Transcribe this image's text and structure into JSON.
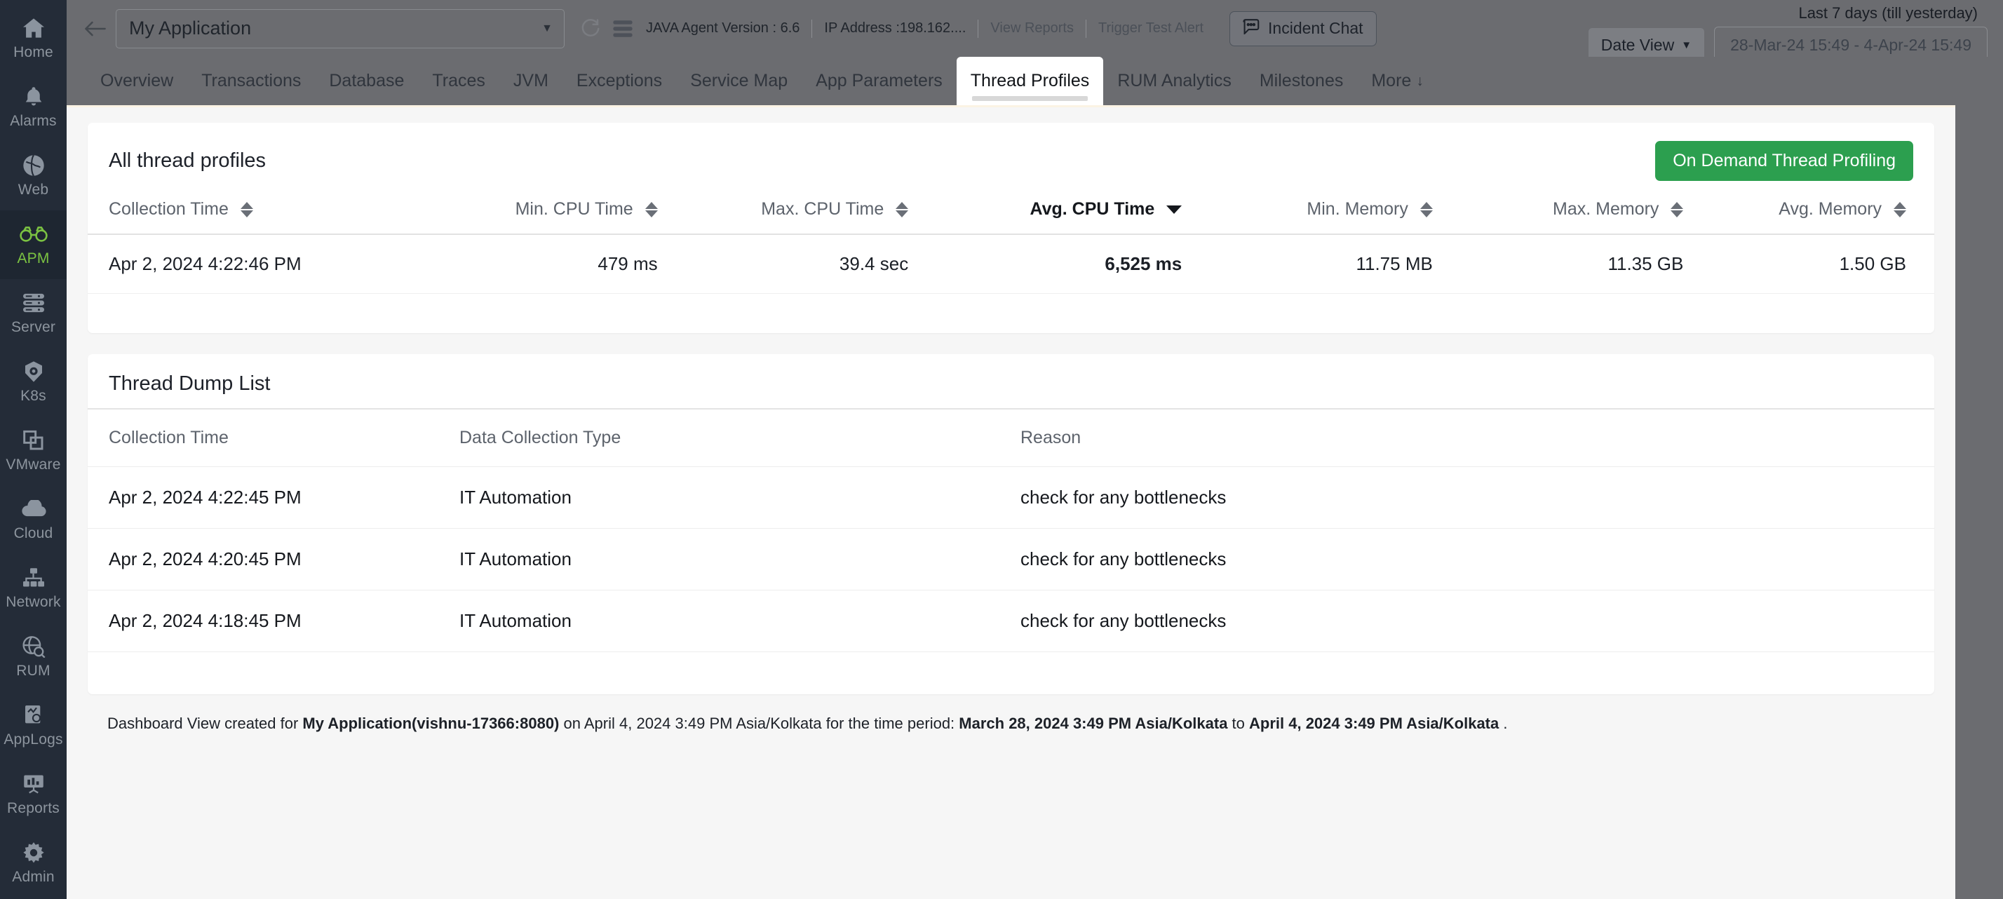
{
  "sidebar": {
    "items": [
      {
        "label": "Home",
        "icon": "home-icon",
        "active": false
      },
      {
        "label": "Alarms",
        "icon": "bell-icon",
        "active": false
      },
      {
        "label": "Web",
        "icon": "globe-icon",
        "active": false
      },
      {
        "label": "APM",
        "icon": "binoculars-icon",
        "active": true
      },
      {
        "label": "Server",
        "icon": "server-icon",
        "active": false
      },
      {
        "label": "K8s",
        "icon": "kubernetes-icon",
        "active": false
      },
      {
        "label": "VMware",
        "icon": "windows-stack-icon",
        "active": false
      },
      {
        "label": "Cloud",
        "icon": "cloud-icon",
        "active": false
      },
      {
        "label": "Network",
        "icon": "network-icon",
        "active": false
      },
      {
        "label": "RUM",
        "icon": "globe-search-icon",
        "active": false
      },
      {
        "label": "AppLogs",
        "icon": "document-search-icon",
        "active": false
      },
      {
        "label": "Reports",
        "icon": "presentation-chart-icon",
        "active": false
      },
      {
        "label": "Admin",
        "icon": "gear-icon",
        "active": false
      }
    ],
    "accent_active": "#7bc242",
    "background": "#242c38"
  },
  "topbar": {
    "back_icon": "back-arrow-icon",
    "app_selector": {
      "value": "My Application",
      "caret_icon": "chevron-down-icon"
    },
    "refresh_icon": "refresh-icon",
    "menu_icon": "hamburger-menu-icon",
    "agent_version": "JAVA Agent Version : 6.6",
    "ip_address": "IP Address :198.162....",
    "view_reports": "View Reports",
    "trigger_test_alert": "Trigger Test Alert",
    "incident_chat": {
      "label": "Incident Chat",
      "icon": "chat-bubble-icon"
    },
    "date_range": {
      "title": "Last 7 days (till yesterday)",
      "date_view_label": "Date View",
      "value": "28-Mar-24 15:49 - 4-Apr-24 15:49"
    }
  },
  "tabs": [
    {
      "label": "Overview",
      "active": false
    },
    {
      "label": "Transactions",
      "active": false
    },
    {
      "label": "Database",
      "active": false
    },
    {
      "label": "Traces",
      "active": false
    },
    {
      "label": "JVM",
      "active": false
    },
    {
      "label": "Exceptions",
      "active": false
    },
    {
      "label": "Service Map",
      "active": false
    },
    {
      "label": "App Parameters",
      "active": false
    },
    {
      "label": "Thread Profiles",
      "active": true
    },
    {
      "label": "RUM Analytics",
      "active": false
    },
    {
      "label": "Milestones",
      "active": false
    },
    {
      "label": "More",
      "active": false,
      "arrow": "↓"
    }
  ],
  "all_thread_profiles": {
    "title": "All thread profiles",
    "action_button": "On Demand Thread Profiling",
    "action_button_color": "#2c9f4f",
    "columns": [
      {
        "label": "Collection Time",
        "align": "left",
        "sorted": false,
        "sort_icon": "sort-both-icon"
      },
      {
        "label": "Min. CPU Time",
        "align": "right",
        "sorted": false,
        "sort_icon": "sort-both-icon"
      },
      {
        "label": "Max. CPU Time",
        "align": "right",
        "sorted": false,
        "sort_icon": "sort-both-icon"
      },
      {
        "label": "Avg. CPU Time",
        "align": "right",
        "sorted": true,
        "sort_icon": "sort-desc-icon"
      },
      {
        "label": "Min. Memory",
        "align": "right",
        "sorted": false,
        "sort_icon": "sort-both-icon"
      },
      {
        "label": "Max. Memory",
        "align": "right",
        "sorted": false,
        "sort_icon": "sort-both-icon"
      },
      {
        "label": "Avg. Memory",
        "align": "right",
        "sorted": false,
        "sort_icon": "sort-both-icon"
      }
    ],
    "rows": [
      {
        "collection_time": "Apr 2, 2024 4:22:46 PM",
        "min_cpu_time": "479 ms",
        "max_cpu_time": "39.4 sec",
        "avg_cpu_time": "6,525 ms",
        "min_memory": "11.75 MB",
        "max_memory": "11.35 GB",
        "avg_memory": "1.50 GB"
      }
    ]
  },
  "thread_dump_list": {
    "title": "Thread Dump List",
    "columns": [
      "Collection Time",
      "Data Collection Type",
      "Reason"
    ],
    "rows": [
      {
        "collection_time": "Apr 2, 2024 4:22:45 PM",
        "type": "IT Automation",
        "reason": "check for any bottlenecks"
      },
      {
        "collection_time": "Apr 2, 2024 4:20:45 PM",
        "type": "IT Automation",
        "reason": "check for any bottlenecks"
      },
      {
        "collection_time": "Apr 2, 2024 4:18:45 PM",
        "type": "IT Automation",
        "reason": "check for any bottlenecks"
      }
    ]
  },
  "footer": {
    "prefix": "Dashboard View created for ",
    "app": "My Application(vishnu-17366:8080)",
    "mid1": " on April 4, 2024 3:49 PM Asia/Kolkata for the time period: ",
    "from": "March 28, 2024 3:49 PM Asia/Kolkata",
    "mid2": " to ",
    "to": "April 4, 2024 3:49 PM Asia/Kolkata",
    "suffix": " ."
  }
}
